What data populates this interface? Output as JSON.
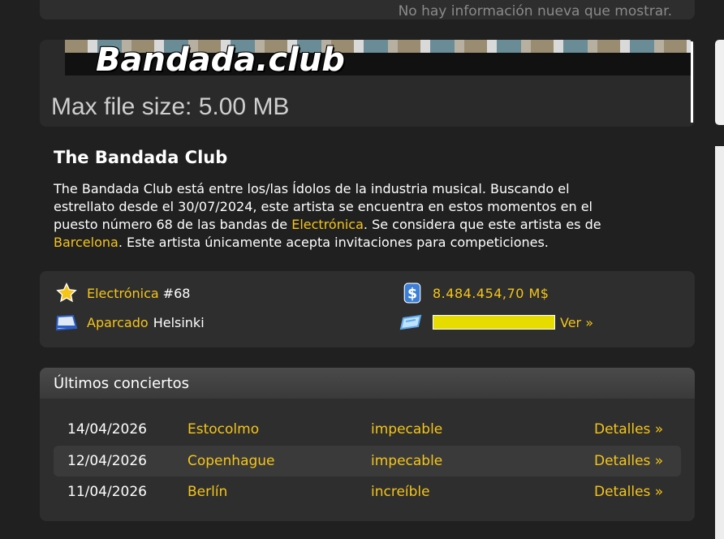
{
  "top_panel": {
    "message": "No hay información nueva que mostrar."
  },
  "banner": {
    "logo_text": "Bandada.club",
    "max_file_size": "Max file size: 5.00 MB"
  },
  "band": {
    "name": "The Bandada Club",
    "desc_line1": "The Bandada Club está entre los/las Ídolos de la industria musical. Buscando el",
    "desc_line2": "estrellato desde el 30/07/2024, este artista se encuentra en estos momentos en el",
    "desc_line3_pre": "puesto número 68 de las bandas de ",
    "desc_genre_link": "Electrónica",
    "desc_line3_post": ". Se considera que este artista es de",
    "desc_city_link": "Barcelona",
    "desc_line4_post": ". Este artista únicamente acepta invitaciones para competiciones."
  },
  "stats": {
    "genre_label": "Electrónica",
    "genre_rank": "#68",
    "location_label": "Aparcado",
    "location_city": "Helsinki",
    "money": "8.484.454,70 M$",
    "tour_progress": 1.0,
    "tour_link": "Ver »"
  },
  "concerts": {
    "title": "Últimos conciertos",
    "rows": [
      {
        "date": "14/04/2026",
        "city": "Estocolmo",
        "rating": "impecable",
        "details": "Detalles »"
      },
      {
        "date": "12/04/2026",
        "city": "Copenhague",
        "rating": "impecable",
        "details": "Detalles »"
      },
      {
        "date": "11/04/2026",
        "city": "Berlín",
        "rating": "increíble",
        "details": "Detalles »"
      }
    ]
  },
  "colors": {
    "background": "#202020",
    "panel": "#2e2e2e",
    "accent": "#f5c518",
    "bar": "#e6dc00"
  },
  "icons": [
    "star-icon",
    "truck-icon",
    "dollar-icon",
    "ticket-icon"
  ]
}
